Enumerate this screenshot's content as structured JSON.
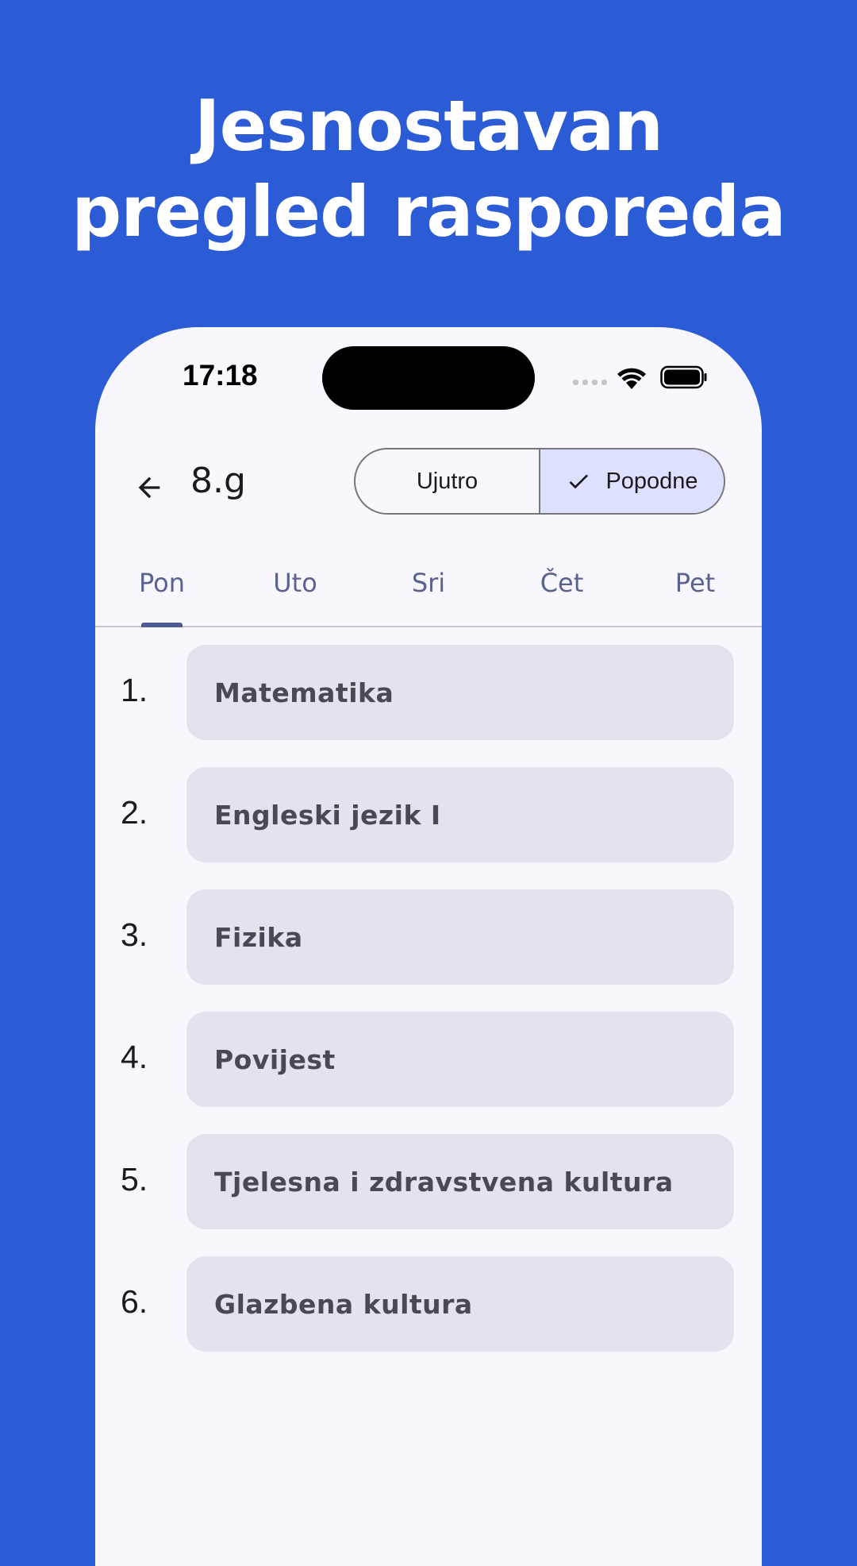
{
  "headline": {
    "line1": "Jesnostavan",
    "line2": "pregled rasporeda"
  },
  "colors": {
    "background": "#2B5CD6",
    "surface": "#F8F7FE",
    "segment_selected": "#DDE1FF",
    "card": "#E4E2EC",
    "tab_indicator": "#4F5B93"
  },
  "status_bar": {
    "time": "17:18",
    "icons": [
      "signal-icon",
      "wifi-icon",
      "battery-icon"
    ]
  },
  "app_bar": {
    "back_icon": "arrow-left-icon",
    "title": "8.g",
    "shift_toggle": {
      "options": [
        "Ujutro",
        "Popodne"
      ],
      "selected": "Popodne",
      "selected_icon": "check-icon"
    }
  },
  "tabs": {
    "items": [
      "Pon",
      "Uto",
      "Sri",
      "Čet",
      "Pet"
    ],
    "selected": "Pon"
  },
  "schedule": [
    {
      "num": "1.",
      "subject": "Matematika"
    },
    {
      "num": "2.",
      "subject": "Engleski jezik I"
    },
    {
      "num": "3.",
      "subject": "Fizika"
    },
    {
      "num": "4.",
      "subject": "Povijest"
    },
    {
      "num": "5.",
      "subject": "Tjelesna i zdravstvena kultura"
    },
    {
      "num": "6.",
      "subject": "Glazbena kultura"
    }
  ]
}
